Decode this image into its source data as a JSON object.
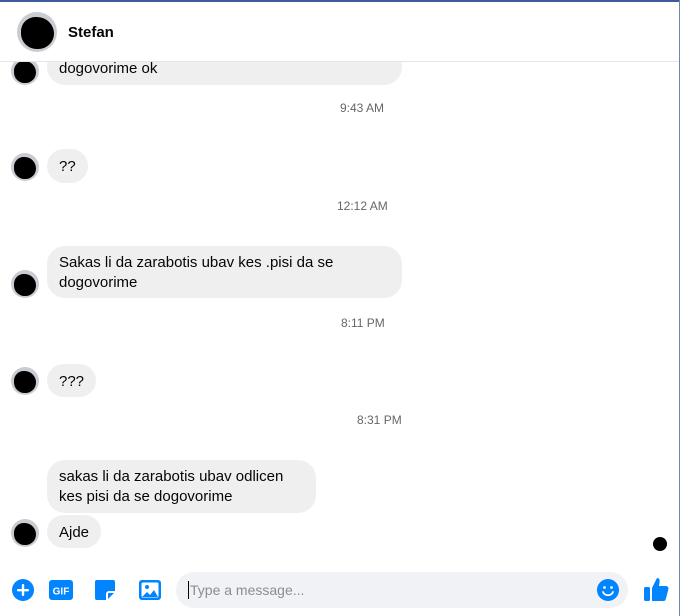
{
  "header": {
    "contact_name": "Stefan"
  },
  "messages": [
    {
      "text": "dogovorime ok"
    },
    {
      "text": "??"
    },
    {
      "text": "Sakas li da zarabotis ubav kes .pisi da se dogovorime"
    },
    {
      "text": "???"
    },
    {
      "text": "sakas li da zarabotis ubav odlicen kes pisi da se dogovorime"
    },
    {
      "text": "Ajde"
    }
  ],
  "timestamps": [
    "9:43 AM",
    "12:12 AM",
    "8:11 PM",
    "8:31 PM"
  ],
  "composer": {
    "placeholder": "Type a message...",
    "icons": [
      "plus-icon",
      "gif-icon",
      "sticker-icon",
      "image-icon",
      "emoji-icon",
      "thumbs-up-icon"
    ]
  },
  "colors": {
    "accent": "#0084ff",
    "bubble": "#f0eff0",
    "timestamp": "#65676b"
  }
}
